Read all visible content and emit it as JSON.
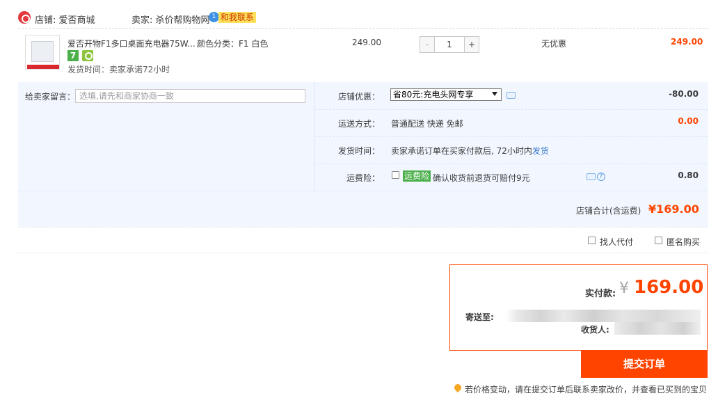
{
  "shop": {
    "label": "店铺: 爱否商城",
    "seller": "卖家: 杀价帮购物网",
    "chat_count": "1",
    "contact": "和我联系"
  },
  "item": {
    "title": "爱否开物F1多口桌面充电器75W...",
    "sku": "颜色分类：F1 白色",
    "badge_7": "7",
    "ship_time": "发货时间：卖家承诺72小时",
    "unit_price": "249.00",
    "qty_minus": "-",
    "quantity": "1",
    "qty_plus": "+",
    "discount": "无优惠",
    "total": "249.00"
  },
  "options": {
    "message_label": "给卖家留言：",
    "message_placeholder": "选填,请先和商家协商一致",
    "shop_discount_label": "店铺优惠：",
    "shop_discount_value": "省80元:充电头网专享",
    "shop_discount_amount": "-80.00",
    "shipping_label": "运送方式：",
    "shipping_value": "普通配送 快递 免邮",
    "shipping_amount": "0.00",
    "dispatch_label": "发货时间：",
    "dispatch_value": "卖家承诺订单在买家付款后, 72小时内",
    "dispatch_link": "发货",
    "insurance_label": "运费险：",
    "insurance_tag": "运费险",
    "insurance_text": "确认收货前退货可赔付9元",
    "insurance_amount": "0.80",
    "help_glyph": "?"
  },
  "summary": {
    "label": "店铺合计(含运费)",
    "value": "¥169.00"
  },
  "extras": {
    "proxy_pay": "找人代付",
    "anonymous": "匿名购买"
  },
  "payment": {
    "label": "实付款:",
    "currency": "¥",
    "value": "169.00",
    "ship_to_label": "寄送至:",
    "receiver_label": "收货人:"
  },
  "submit": {
    "label": "提交订单"
  },
  "notice": "若价格变动，请在提交订单后联系卖家改价，并查看已买到的宝贝",
  "colors": {
    "accent": "#ff4400",
    "panel_bg": "#f2f7ff",
    "insurance_green": "#4bb04b",
    "contact_yellow": "#ffe05a"
  }
}
